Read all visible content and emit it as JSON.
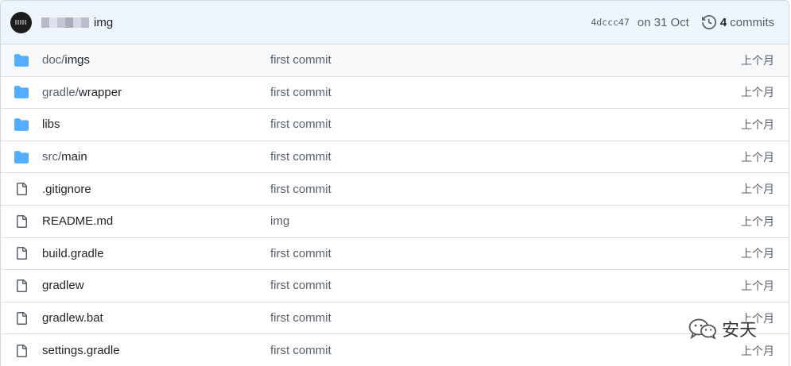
{
  "commit_bar": {
    "message": "img",
    "sha": "4dccc47",
    "date": "on 31 Oct",
    "commit_count": "4",
    "commits_label": "commits"
  },
  "files": [
    {
      "dir_prefix": "doc/",
      "name": "imgs",
      "type": "folder",
      "message": "first commit",
      "time": "上个月"
    },
    {
      "dir_prefix": "gradle/",
      "name": "wrapper",
      "type": "folder",
      "message": "first commit",
      "time": "上个月"
    },
    {
      "dir_prefix": "",
      "name": "libs",
      "type": "folder",
      "message": "first commit",
      "time": "上个月"
    },
    {
      "dir_prefix": "src/",
      "name": "main",
      "type": "folder",
      "message": "first commit",
      "time": "上个月"
    },
    {
      "dir_prefix": "",
      "name": ".gitignore",
      "type": "file",
      "message": "first commit",
      "time": "上个月"
    },
    {
      "dir_prefix": "",
      "name": "README.md",
      "type": "file",
      "message": "img",
      "time": "上个月"
    },
    {
      "dir_prefix": "",
      "name": "build.gradle",
      "type": "file",
      "message": "first commit",
      "time": "上个月"
    },
    {
      "dir_prefix": "",
      "name": "gradlew",
      "type": "file",
      "message": "first commit",
      "time": "上个月"
    },
    {
      "dir_prefix": "",
      "name": "gradlew.bat",
      "type": "file",
      "message": "first commit",
      "time": "上个月"
    },
    {
      "dir_prefix": "",
      "name": "settings.gradle",
      "type": "file",
      "message": "first commit",
      "time": "上个月"
    }
  ],
  "watermark": {
    "text": "安天",
    "icon": "wechat-icon"
  },
  "colors": {
    "folder": "#54aeff",
    "header_bg": "#eef5fd",
    "muted": "#57606a"
  }
}
